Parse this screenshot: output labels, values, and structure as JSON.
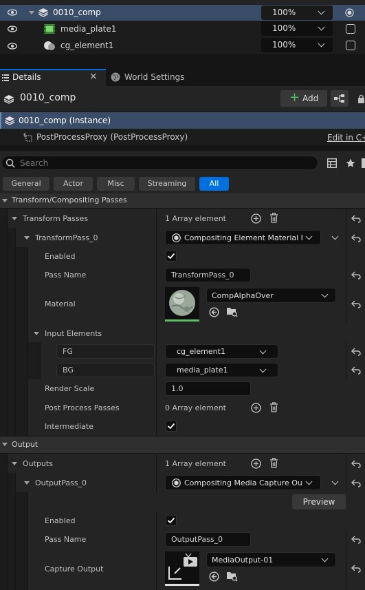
{
  "outliner": {
    "rows": [
      {
        "name": "0010_comp",
        "opacity": "100%",
        "selected": true
      },
      {
        "name": "media_plate1",
        "opacity": "100%",
        "selected": false
      },
      {
        "name": "cg_element1",
        "opacity": "100%",
        "selected": false
      }
    ]
  },
  "tabs": {
    "details_label": "Details",
    "close_glyph": "×",
    "world_settings_label": "World Settings"
  },
  "header": {
    "object_name": "0010_comp",
    "add_label": "Add",
    "add_glyph": "+"
  },
  "components": {
    "instance_label": "0010_comp (Instance)",
    "proxy_label": "PostProcessProxy (PostProcessProxy)",
    "edit_link": "Edit in C++"
  },
  "search": {
    "placeholder": "Search"
  },
  "filters": [
    "General",
    "Actor",
    "Misc",
    "Streaming",
    "All"
  ],
  "details": {
    "transform_section": "Transform/Compositing Passes",
    "transform_passes_label": "Transform Passes",
    "transform_passes_value": "1 Array element",
    "transform_pass0_label": "TransformPass_0",
    "transform_pass0_class": "Compositing Element Material Pass",
    "enabled_label": "Enabled",
    "pass_name_label": "Pass Name",
    "pass_name_value": "TransformPass_0",
    "material_label": "Material",
    "material_value": "CompAlphaOver",
    "input_elements_label": "Input Elements",
    "fg_label": "FG",
    "fg_value": "cg_element1",
    "bg_label": "BG",
    "bg_value": "media_plate1",
    "render_scale_label": "Render Scale",
    "render_scale_value": "1.0",
    "post_process_label": "Post Process Passes",
    "post_process_value": "0 Array element",
    "intermediate_label": "Intermediate",
    "output_section": "Output",
    "outputs_label": "Outputs",
    "outputs_value": "1 Array element",
    "output_pass0_label": "OutputPass_0",
    "output_pass0_class": "Compositing Media Capture Output",
    "preview_label": "Preview",
    "out_enabled_label": "Enabled",
    "out_pass_name_label": "Pass Name",
    "out_pass_name_value": "OutputPass_0",
    "capture_output_label": "Capture Output",
    "capture_output_value": "MediaOutput-01"
  },
  "colors": {
    "accent_blue": "#0070e0",
    "selection_row": "#3a4d68",
    "panel_bg": "#242424",
    "add_green": "#49c25c"
  }
}
